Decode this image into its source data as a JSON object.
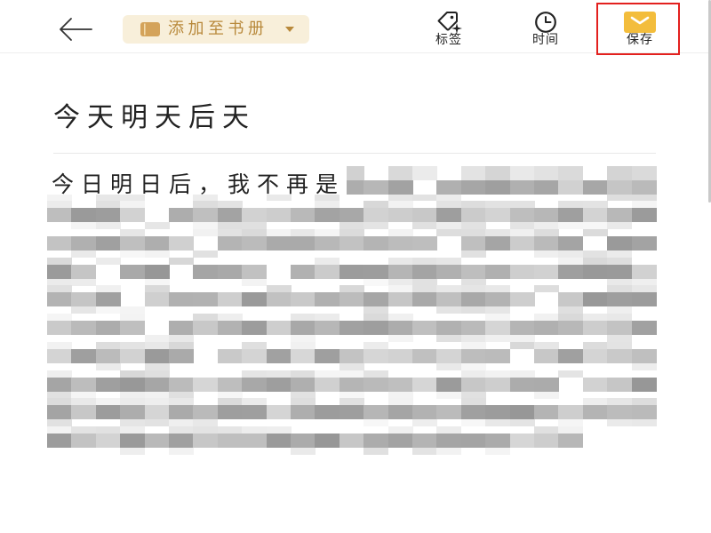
{
  "header": {
    "back_button": {
      "icon": "back-arrow-icon"
    },
    "notebook_button": {
      "label": "添加至书册",
      "icon": "notebook-icon",
      "caret_icon": "chevron-down-icon"
    },
    "actions": [
      {
        "label": "标签",
        "icon": "tag-icon"
      },
      {
        "label": "时间",
        "icon": "clock-icon"
      },
      {
        "label": "保存",
        "icon": "save-icon"
      }
    ]
  },
  "note": {
    "title": "今天明天后天",
    "body_text": "今日明日后，我不再是"
  },
  "colors": {
    "accent": "#f3bd3c",
    "pill_background": "#f8efda",
    "pill_text": "#b8893b",
    "highlight_box": "#e3201e",
    "text": "#222222"
  }
}
